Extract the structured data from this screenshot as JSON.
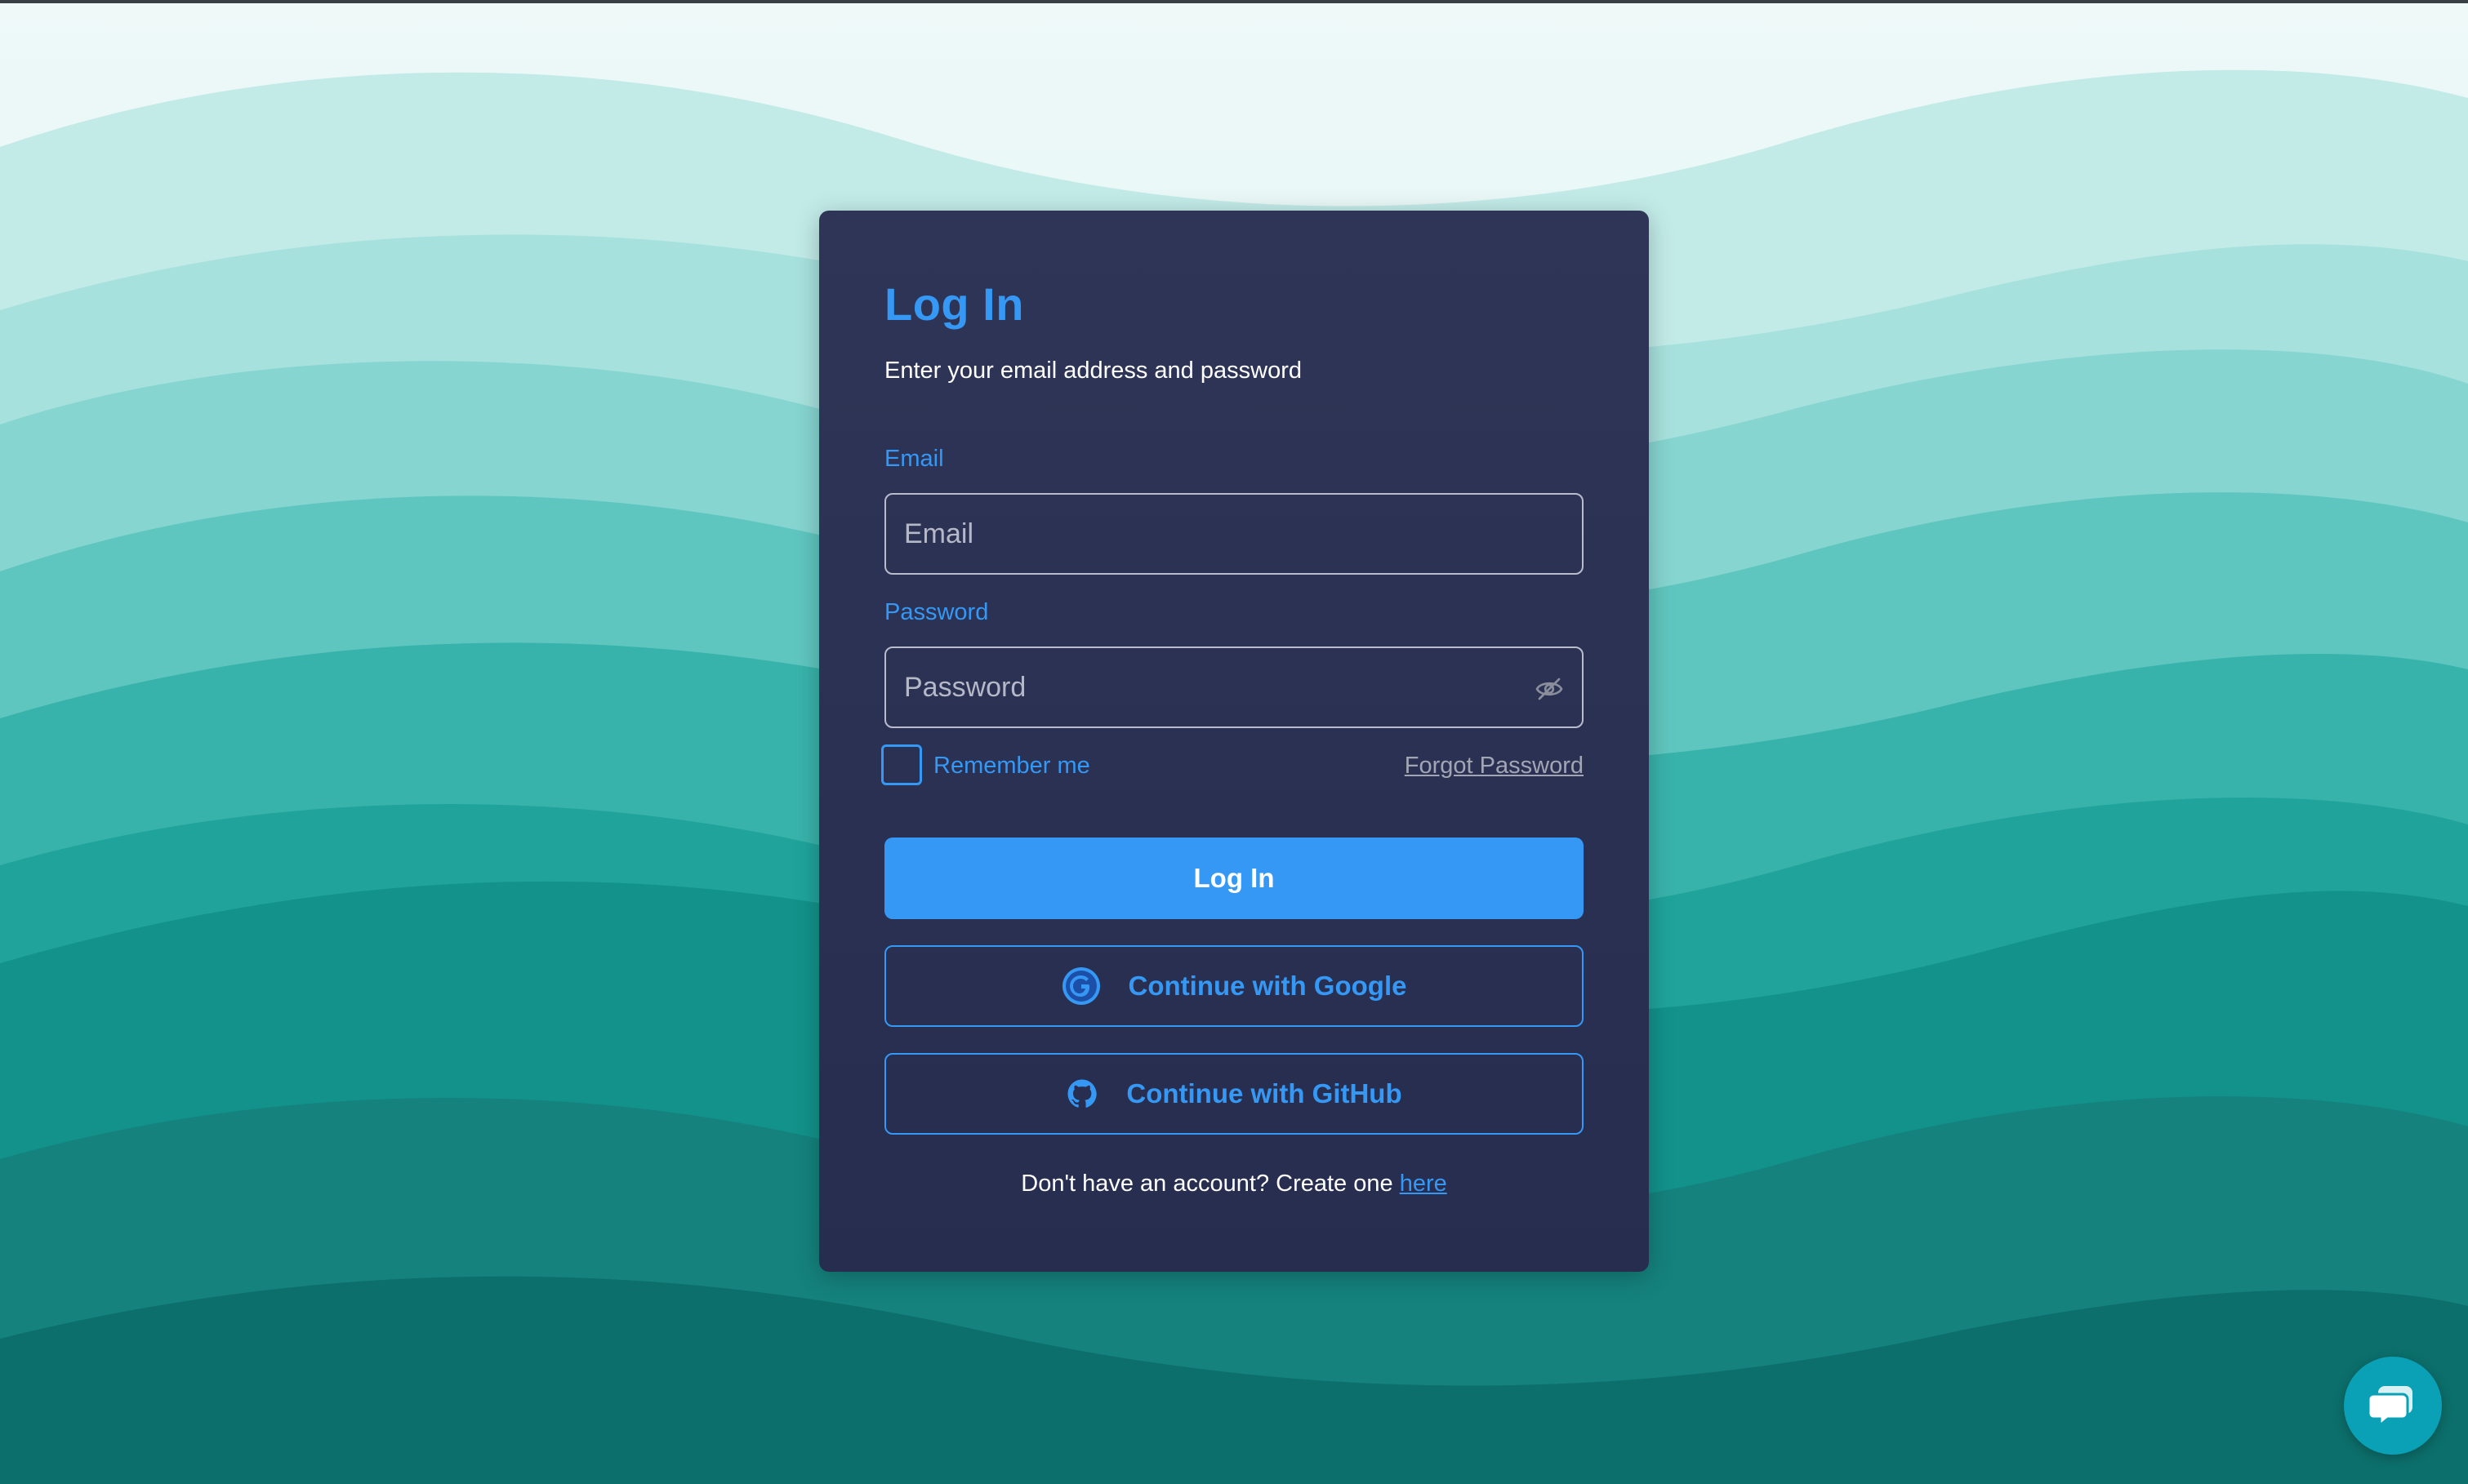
{
  "login": {
    "title": "Log In",
    "subtitle": "Enter your email address and password",
    "email_label": "Email",
    "email_placeholder": "Email",
    "email_value": "",
    "password_label": "Password",
    "password_placeholder": "Password",
    "password_value": "",
    "remember_label": "Remember me",
    "remember_checked": false,
    "forgot_label": "Forgot Password",
    "login_button": "Log In",
    "google_button": "Continue with Google",
    "github_button": "Continue with GitHub",
    "signup_prompt": "Don't have an account? Create one",
    "signup_link": "here"
  },
  "icons": {
    "password_toggle": "eye-off-icon",
    "google": "google-icon",
    "github": "github-icon",
    "chat": "chat-icon"
  },
  "colors": {
    "accent": "#3598f5",
    "card_background": "#2b3153",
    "background_teal": "#0f7f7b",
    "chat_button": "#0aa0b6"
  }
}
